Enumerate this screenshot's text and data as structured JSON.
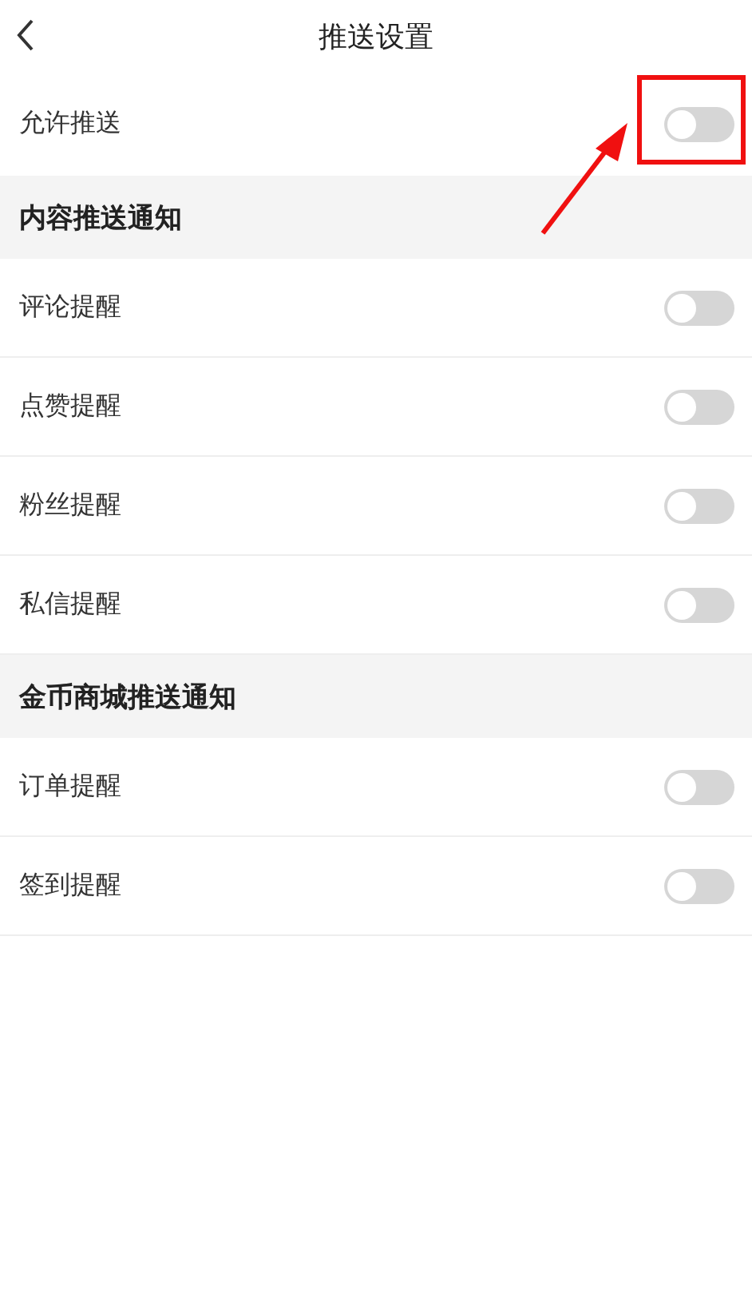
{
  "header": {
    "title": "推送设置"
  },
  "master": {
    "label": "允许推送",
    "on": false
  },
  "sections": [
    {
      "title": "内容推送通知",
      "items": [
        {
          "label": "评论提醒",
          "on": false
        },
        {
          "label": "点赞提醒",
          "on": false
        },
        {
          "label": "粉丝提醒",
          "on": false
        },
        {
          "label": "私信提醒",
          "on": false
        }
      ]
    },
    {
      "title": "金币商城推送通知",
      "items": [
        {
          "label": "订单提醒",
          "on": false
        },
        {
          "label": "签到提醒",
          "on": false
        }
      ]
    }
  ]
}
